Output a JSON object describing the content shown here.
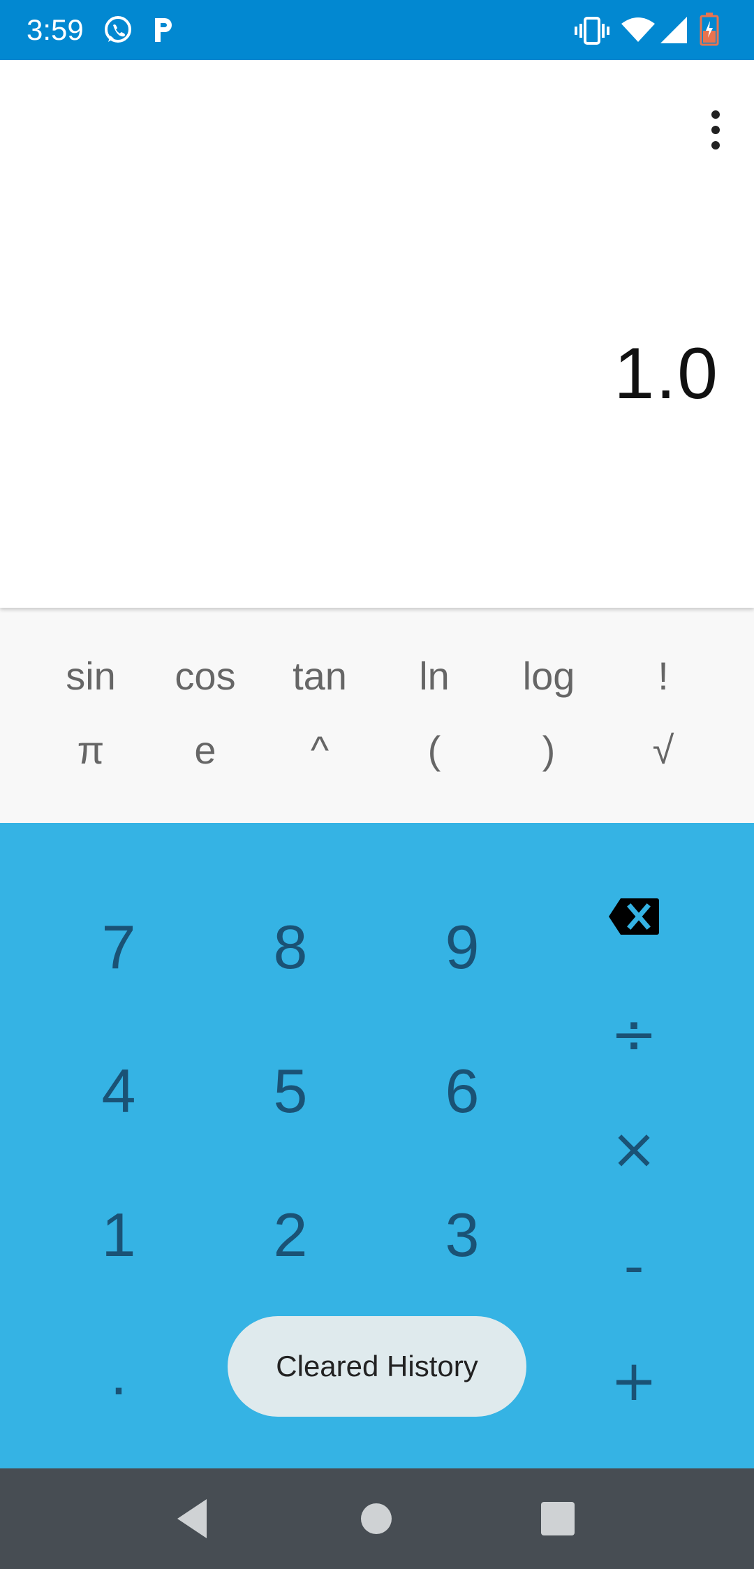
{
  "status_bar": {
    "time": "3:59",
    "left_icons": [
      "whatsapp-icon",
      "p-app-icon"
    ],
    "right_icons": [
      "vibrate-icon",
      "wifi-icon",
      "signal-icon",
      "battery-icon"
    ],
    "bar_color": "#0288d1"
  },
  "display": {
    "result": "1.0",
    "menu_icon": "more-vert-icon"
  },
  "scientific": {
    "row1": [
      "sin",
      "cos",
      "tan",
      "ln",
      "log",
      "!"
    ],
    "row2": [
      "π",
      "e",
      "^",
      "(",
      ")",
      "√"
    ]
  },
  "keypad": {
    "row1": [
      "7",
      "8",
      "9"
    ],
    "row2": [
      "4",
      "5",
      "6"
    ],
    "row3": [
      "1",
      "2",
      "3"
    ],
    "row4": [
      "."
    ],
    "operators": {
      "backspace": "backspace-icon",
      "divide": "÷",
      "multiply": "×",
      "subtract": "-",
      "add": "+"
    },
    "background_color": "#35b3e4",
    "key_color": "#1a5275"
  },
  "toast": {
    "message": "Cleared History"
  },
  "nav_bar": {
    "icons": [
      "back-icon",
      "home-icon",
      "recents-icon"
    ]
  }
}
